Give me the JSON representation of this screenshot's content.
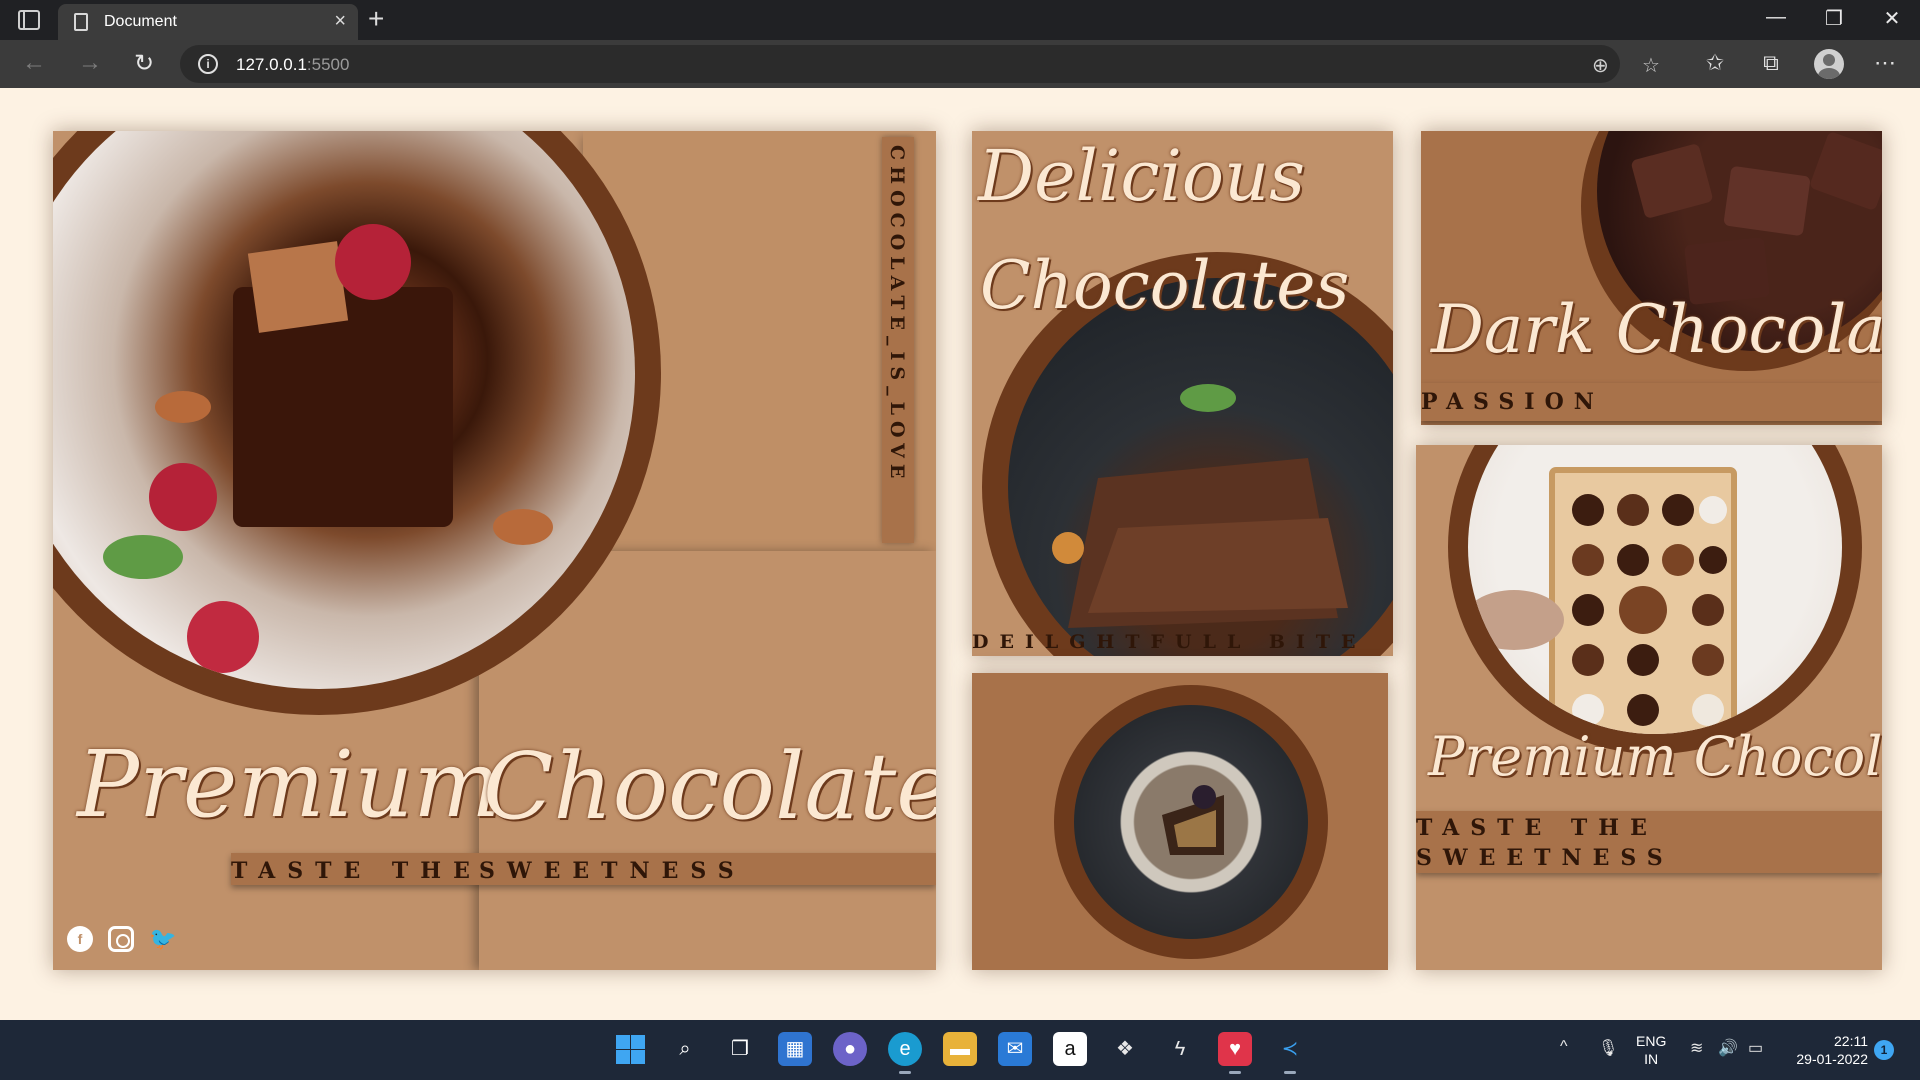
{
  "browser": {
    "tab_title": "Document",
    "tab_close": "×",
    "new_tab": "+",
    "url_host": "127.0.0.1",
    "url_port": ":5500",
    "window_controls": {
      "minimize": "—",
      "maximize": "❐",
      "close": "✕"
    },
    "icons": [
      "sidebar-toggle-icon",
      "page-icon",
      "back-arrow-icon",
      "forward-arrow-icon",
      "reload-icon",
      "info-icon",
      "zoom-icon",
      "favorite-add-icon",
      "favorites-icon",
      "collections-icon",
      "profile-icon",
      "more-icon"
    ]
  },
  "page": {
    "card1": {
      "vertical_tag": "CHOCOLATE_IS_LOVE",
      "title_left": "Premium",
      "title_right": "Chocolate",
      "tagline_left": "TASTE THE",
      "tagline_right": "SWEETNESS",
      "social": [
        "facebook-icon",
        "instagram-icon",
        "twitter-icon"
      ]
    },
    "card2": {
      "title_line1": "Delicious",
      "title_line2": "Chocolates",
      "tagline": "DEILGHTFULL BITE"
    },
    "card4": {
      "title": "Dark Chocolates",
      "tagline": "PASSION"
    },
    "card5": {
      "title": "Premium Chocolates",
      "tagline_line1": "TASTE THE",
      "tagline_line2": "SWEETNESS"
    },
    "colors": {
      "background": "#fdf2e3",
      "card": "#c0916a",
      "card_dark": "#a8724a",
      "ring": "#6d3a1c",
      "script_text": "#fbe8d2",
      "band_text": "#2f1608"
    }
  },
  "taskbar": {
    "language": "ENG",
    "region": "IN",
    "time": "22:11",
    "date": "29-01-2022",
    "notification_count": "1",
    "apps": [
      "start-icon",
      "search-icon",
      "task-view-icon",
      "widgets-icon",
      "chat-icon",
      "edge-icon",
      "file-explorer-icon",
      "mail-icon",
      "amazon-icon",
      "dropbox-icon",
      "app-icon",
      "media-app-icon",
      "vscode-icon"
    ]
  }
}
